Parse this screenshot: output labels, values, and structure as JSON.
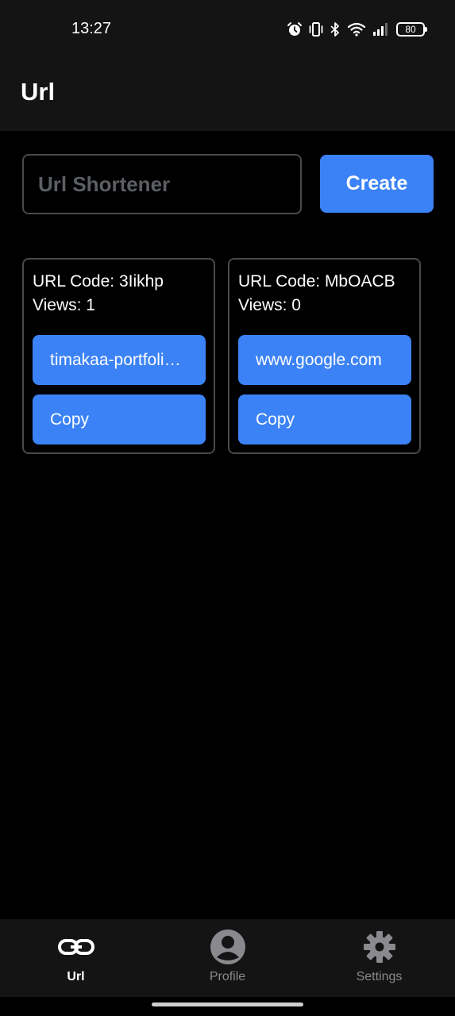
{
  "status_bar": {
    "time": "13:27",
    "battery": "80",
    "icons": [
      "alarm-icon",
      "vibrate-icon",
      "bluetooth-icon",
      "wifi-icon",
      "signal-icon",
      "battery-icon"
    ]
  },
  "app_bar": {
    "title": "Url"
  },
  "form": {
    "input_placeholder": "Url Shortener",
    "input_value": "",
    "create_label": "Create"
  },
  "cards": [
    {
      "code_text": "URL Code: 3Iikhp",
      "views_text": "Views: 1",
      "link_label": "timakaa-portfolio.vercel.app",
      "copy_label": "Copy"
    },
    {
      "code_text": "URL Code: MbOACB",
      "views_text": "Views: 0",
      "link_label": "www.google.com",
      "copy_label": "Copy"
    }
  ],
  "bottom_nav": {
    "items": [
      {
        "label": "Url",
        "icon": "link-icon",
        "active": true
      },
      {
        "label": "Profile",
        "icon": "profile-icon",
        "active": false
      },
      {
        "label": "Settings",
        "icon": "gear-icon",
        "active": false
      }
    ]
  },
  "colors": {
    "accent": "#3b82f6",
    "background": "#000000",
    "surface": "#141414",
    "border": "#4a4a4e",
    "inactive": "#8a8a8e"
  }
}
